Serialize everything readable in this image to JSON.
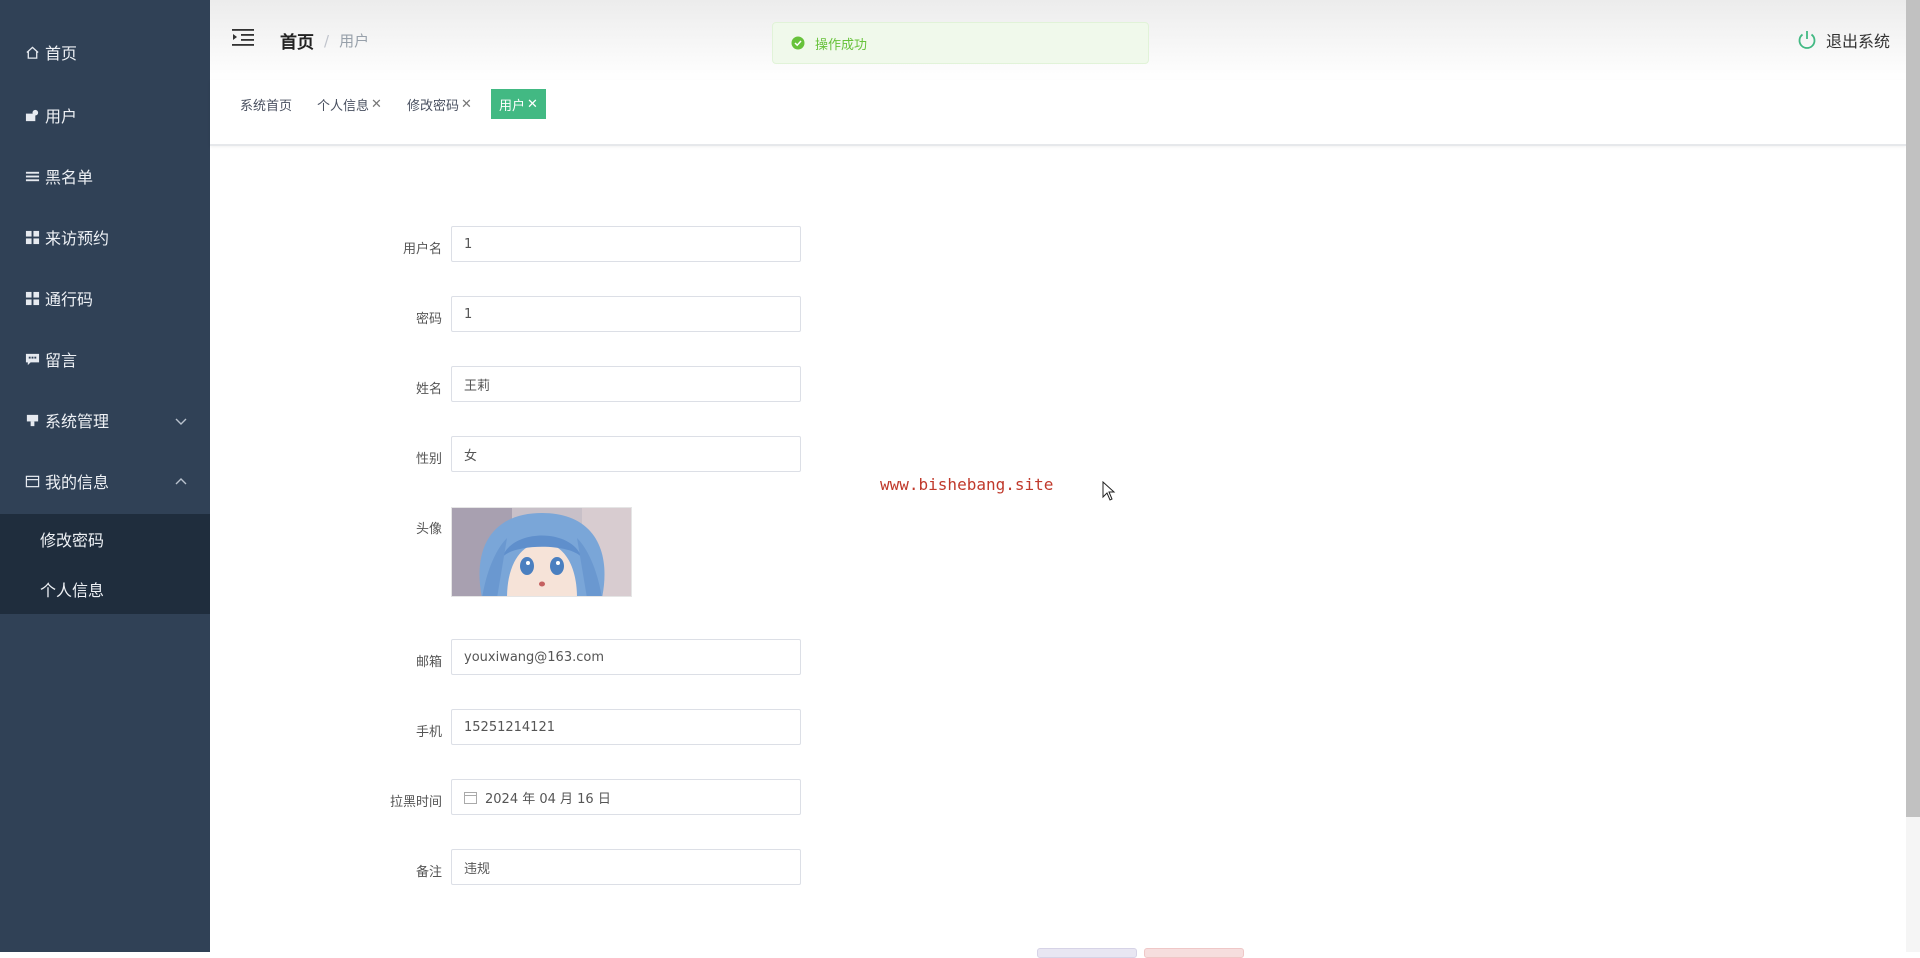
{
  "sidebar": {
    "items": [
      {
        "label": "首页",
        "icon": "home-icon"
      },
      {
        "label": "用户",
        "icon": "user-card-icon"
      },
      {
        "label": "黑名单",
        "icon": "list-icon"
      },
      {
        "label": "来访预约",
        "icon": "grid-icon"
      },
      {
        "label": "通行码",
        "icon": "grid-icon"
      },
      {
        "label": "留言",
        "icon": "message-icon"
      },
      {
        "label": "系统管理",
        "icon": "gear-icon"
      },
      {
        "label": "我的信息",
        "icon": "id-card-icon"
      }
    ],
    "submenu": [
      {
        "label": "修改密码"
      },
      {
        "label": "个人信息"
      }
    ]
  },
  "header": {
    "breadcrumb_home": "首页",
    "breadcrumb_sep": "/",
    "breadcrumb_current": "用户",
    "logout_label": "退出系统"
  },
  "toast": {
    "message": "操作成功"
  },
  "tabs": [
    {
      "label": "系统首页",
      "closable": false
    },
    {
      "label": "个人信息",
      "closable": true
    },
    {
      "label": "修改密码",
      "closable": true
    },
    {
      "label": "用户",
      "closable": true,
      "active": true
    }
  ],
  "tab_close_glyph": "✕",
  "form": {
    "username": {
      "label": "用户名",
      "value": "1"
    },
    "password": {
      "label": "密码",
      "value": "1"
    },
    "name": {
      "label": "姓名",
      "value": "王莉"
    },
    "gender": {
      "label": "性别",
      "value": "女"
    },
    "avatar": {
      "label": "头像"
    },
    "email": {
      "label": "邮箱",
      "value": "youxiwang@163.com"
    },
    "phone": {
      "label": "手机",
      "value": "15251214121"
    },
    "blacklist_time": {
      "label": "拉黑时间",
      "value": "2024 年 04 月 16 日"
    },
    "remark": {
      "label": "备注",
      "value": "违规"
    }
  },
  "watermark": "www.bishebang.site",
  "colors": {
    "sidebar_bg": "#304156",
    "submenu_bg": "#1f2d3d",
    "active_tab": "#42b983",
    "toast_text": "#67c23a",
    "watermark": "#c0392b"
  }
}
